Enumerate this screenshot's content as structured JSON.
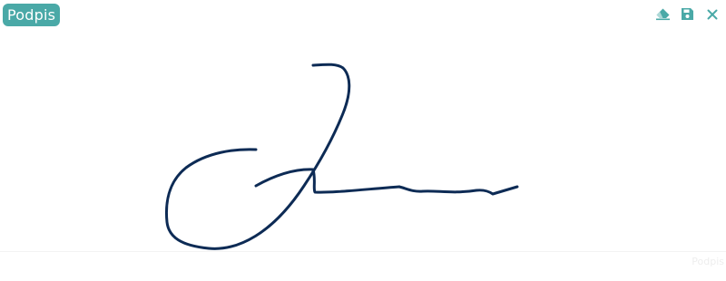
{
  "header": {
    "title": "Podpis"
  },
  "toolbar": {
    "buttons": [
      {
        "icon": "eraser-icon",
        "action": "clear"
      },
      {
        "icon": "save-icon",
        "action": "save"
      },
      {
        "icon": "close-icon",
        "action": "close"
      }
    ]
  },
  "footer": {
    "label": "Podpis"
  },
  "colors": {
    "accent": "#4aa9a7",
    "ink": "#0d2b55",
    "icon": "#4aa9a7"
  }
}
